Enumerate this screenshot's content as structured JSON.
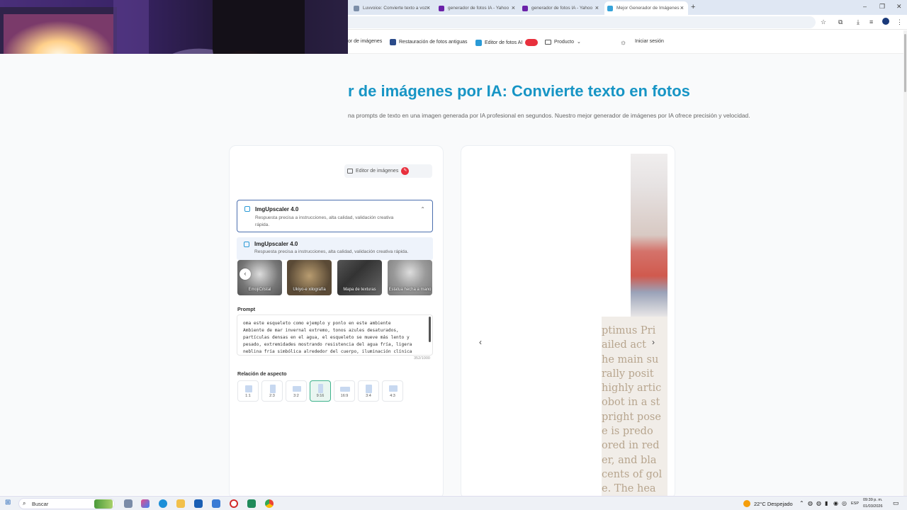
{
  "browser": {
    "tabs": [
      {
        "title": "Luvvoice: Convierte texto a voz",
        "active": false,
        "color": "#7c8ea8"
      },
      {
        "title": "generador de fotos IA - Yahoo",
        "active": false,
        "color": "#6b21a8"
      },
      {
        "title": "generador de fotos IA - Yahoo",
        "active": false,
        "color": "#6b21a8"
      },
      {
        "title": "Mejor Generador de Imágenes",
        "active": true,
        "color": "#36a3d9"
      }
    ],
    "new_tab_icon": "plus-icon"
  },
  "site_nav": {
    "items": [
      "or de imágenes",
      "Restauración de fotos antiguas",
      "Editor de fotos AI",
      "Producto"
    ],
    "login_label": "Iniciar sesión"
  },
  "hero": {
    "title": "r de imágenes por IA: Convierte texto en fotos",
    "subtitle": "na prompts de texto en una imagen generada por IA profesional en segundos. Nuestro mejor generador de imágenes por IA ofrece precisión y velocidad."
  },
  "editor_chip": {
    "label": "Editor de imágenes"
  },
  "model": {
    "name": "ImgUpscaler 4.0",
    "desc": "Respuesta precisa a instrucciones, alta calidad, validación creativa rápida.",
    "option_name": "ImgUpscaler 4.0",
    "option_desc": "Respuesta precisa a instrucciones, alta calidad, validación creativa rápida."
  },
  "styles": [
    {
      "label": "EmojiCristal"
    },
    {
      "label": "Ukiyo-e xilografía"
    },
    {
      "label": "Mapa de texturas"
    },
    {
      "label": "Estatua hecha a mano"
    }
  ],
  "prompt": {
    "label": "Prompt",
    "text": "oma este esqueleto como ejemplo y ponlo en este ambiente\nAmbiente de mar invernal extremo, tonos azules desaturados, partículas densas en el agua, el esqueleto se mueve más lento y pesado, extremidades mostrando resistencia del agua fría, ligera neblina fría simbólica alrededor del cuerpo, iluminación clínica",
    "char_count": "352/1000"
  },
  "aspect": {
    "label": "Relación de aspecto",
    "ratios": [
      "1:1",
      "2:3",
      "3:2",
      "9:16",
      "16:9",
      "3:4",
      "4:3"
    ],
    "selected": "9:16"
  },
  "preview": {
    "text_lines": [
      "ptimus Pri",
      "ailed act",
      "he main su",
      "rally posit",
      "highly artic",
      "obot in a st",
      "pright pose",
      "e is predo",
      "ored in red",
      "er, and bla",
      "cents of gol",
      "e. The hea"
    ]
  },
  "taskbar": {
    "search_label": "Buscar",
    "weather": "22°C  Despejado",
    "lang": "ESP",
    "time": "09:39 p. m.",
    "date": "01/03/2026"
  }
}
